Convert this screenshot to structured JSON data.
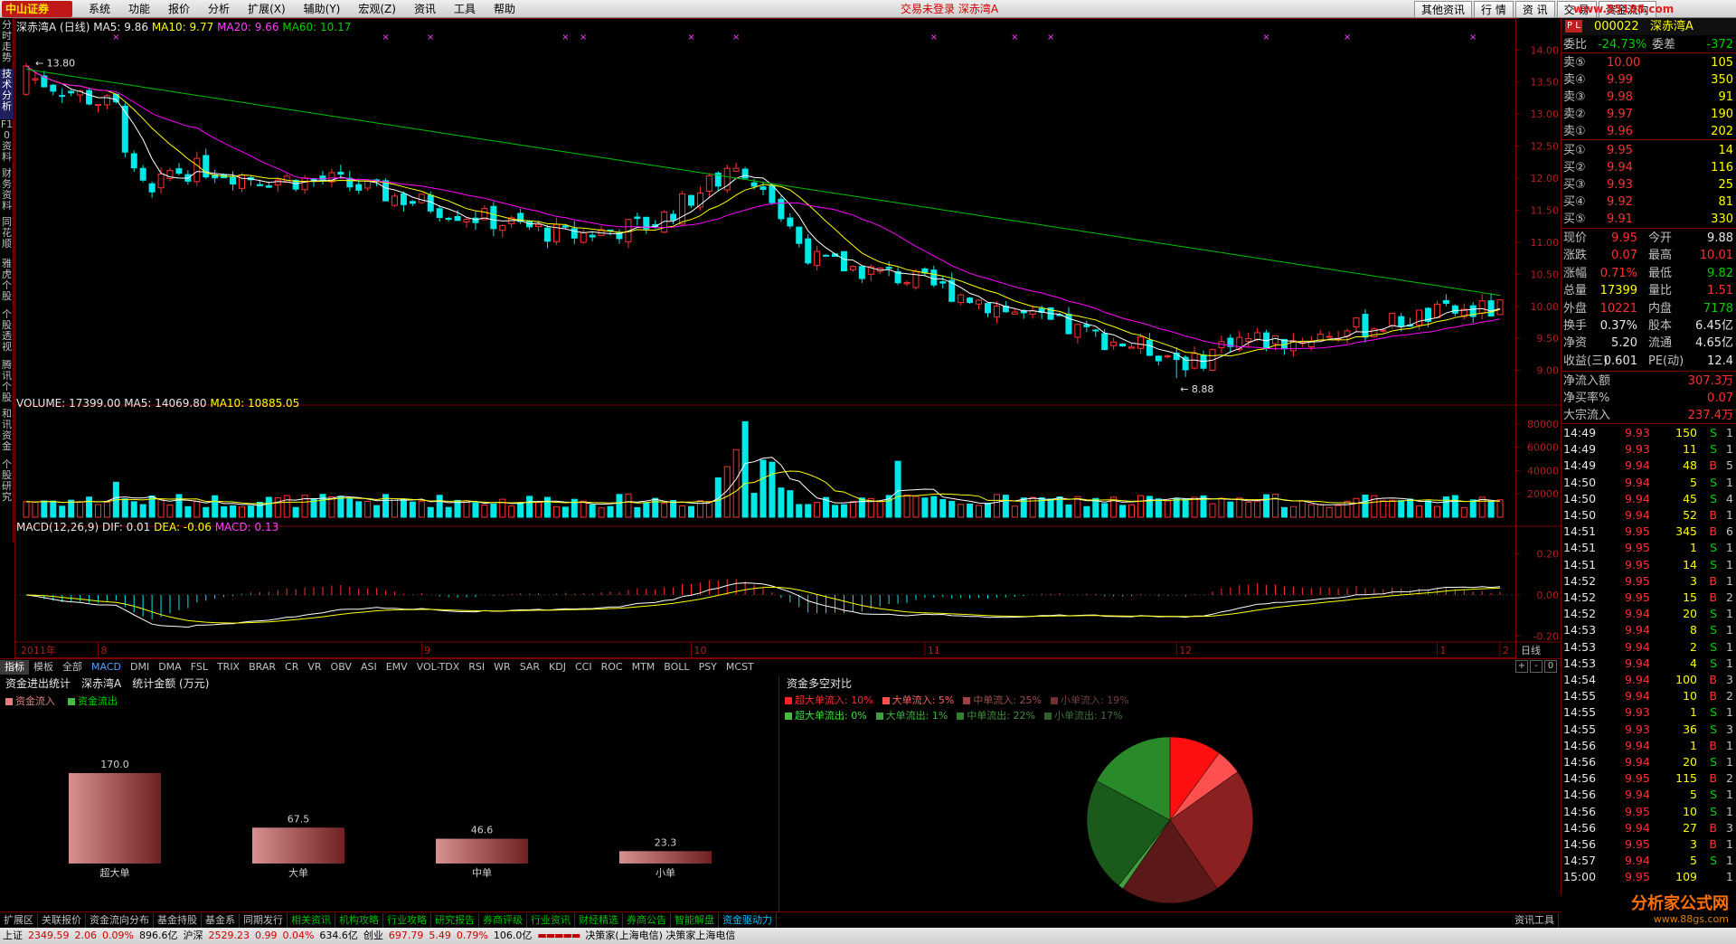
{
  "app": {
    "logo_text": "中山证券",
    "menu": [
      "系统",
      "功能",
      "报价",
      "分析",
      "扩展(X)",
      "辅助(Y)",
      "宏观(Z)",
      "资讯",
      "工具",
      "帮助"
    ],
    "login_status": "交易未登录   深赤湾A",
    "top_tabs": [
      "其他资讯",
      "行 情",
      "资 讯",
      "交 易",
      "资金流向"
    ],
    "watermark": "www.55188.com"
  },
  "left_tabs": [
    "分时走势",
    "技术分析",
    "F10资料",
    "财务资料",
    "同花顺",
    "雅虎个股",
    "个股透视",
    "腾讯个股",
    "和讯资金",
    "个股研究"
  ],
  "kline_header": {
    "title": "深赤湾A (日线)",
    "ma5": "MA5: 9.86",
    "ma10": "MA10: 9.77",
    "ma20": "MA20: 9.66",
    "ma60": "MA60: 10.17",
    "high_mark": "13.80",
    "low_mark": "8.88"
  },
  "volume_header": {
    "vol": "VOLUME: 17399.00",
    "ma5": "MA5: 14069.80",
    "ma10": "MA10: 10885.05"
  },
  "macd_header": {
    "name": "MACD(12,26,9)",
    "dif": "DIF: 0.01",
    "dea": "DEA: -0.06",
    "macd": "MACD: 0.13"
  },
  "x_axis": {
    "labels": [
      "2011年",
      "8",
      "9",
      "10",
      "11",
      "12",
      "1",
      "2"
    ],
    "period": "日线"
  },
  "indicator_tabs": [
    "指标",
    "模板",
    "全部",
    "MACD",
    "DMI",
    "DMA",
    "FSL",
    "TRIX",
    "BRAR",
    "CR",
    "VR",
    "OBV",
    "ASI",
    "EMV",
    "VOL-TDX",
    "RSI",
    "WR",
    "SAR",
    "KDJ",
    "CCI",
    "ROC",
    "MTM",
    "BOLL",
    "PSY",
    "MCST"
  ],
  "indicator_ctrls": [
    "+",
    "-",
    "0"
  ],
  "chart_data": [
    {
      "type": "candlestick",
      "title": "深赤湾A (日线)",
      "ylim": [
        8.6,
        14.3
      ],
      "y_ticks": [
        9.0,
        9.5,
        10.0,
        10.5,
        11.0,
        11.5,
        12.0,
        12.5,
        13.0,
        13.5,
        14.0
      ],
      "series": [
        {
          "name": "MA5",
          "color": "#ffffff"
        },
        {
          "name": "MA10",
          "color": "#ffff00"
        },
        {
          "name": "MA20",
          "color": "#ff00ff"
        },
        {
          "name": "MA60",
          "color": "#00c000"
        }
      ],
      "annotations": [
        "13.80",
        "8.88"
      ]
    },
    {
      "type": "bar",
      "title": "VOLUME",
      "ylim": [
        0,
        90000
      ],
      "y_ticks": [
        20000,
        40000,
        60000,
        80000
      ]
    },
    {
      "type": "bar",
      "title": "MACD(12,26,9)",
      "ylim": [
        -0.3,
        0.3
      ],
      "y_ticks": [
        0.2,
        0.0,
        -0.2
      ],
      "y_tick_labels": [
        "0.20",
        "0.00",
        "-0.20"
      ]
    },
    {
      "type": "bar",
      "title": "资金进出统计",
      "categories": [
        "超大单",
        "大单",
        "中单",
        "小单"
      ],
      "values": [
        170.0,
        67.5,
        46.6,
        23.3
      ],
      "value_labels": [
        "170.0",
        "67.5",
        "46.6",
        "23.3"
      ]
    },
    {
      "type": "pie",
      "title": "资金多空对比",
      "categories": [
        "超大单流入",
        "大单流入",
        "中单流入",
        "小单流入",
        "超大单流出",
        "大单流出",
        "中单流出",
        "小单流出"
      ],
      "values": [
        10,
        5,
        25,
        19,
        0,
        1,
        22,
        17
      ],
      "colors": [
        "#ff1010",
        "#ff5050",
        "#8a2020",
        "#5a1818",
        "#105010",
        "#40a040",
        "#1a5a1a",
        "#2a8a2a"
      ]
    }
  ],
  "panel_left": {
    "tabs": [
      "资金进出统计",
      "深赤湾A",
      "统计金额 (万元)"
    ],
    "legend_in": "资金流入",
    "legend_out": "资金流出"
  },
  "panel_right": {
    "title": "资金多空对比",
    "legend_row1": [
      "超大单流入: 10%",
      "大单流入:   5%",
      "中单流入: 25%",
      "小单流入: 19%"
    ],
    "legend_row2": [
      "超大单流出:  0%",
      "大单流出:   1%",
      "中单流出: 22%",
      "小单流出: 17%"
    ]
  },
  "quote": {
    "code": "000022",
    "name": "深赤湾A",
    "webi_label": "委比",
    "webi": "-24.73%",
    "weicha_label": "委差",
    "weicha": "-372",
    "asks": [
      {
        "label": "卖⑤",
        "price": "10.00",
        "vol": "105"
      },
      {
        "label": "卖④",
        "price": "9.99",
        "vol": "350"
      },
      {
        "label": "卖③",
        "price": "9.98",
        "vol": "91"
      },
      {
        "label": "卖②",
        "price": "9.97",
        "vol": "190"
      },
      {
        "label": "卖①",
        "price": "9.96",
        "vol": "202"
      }
    ],
    "bids": [
      {
        "label": "买①",
        "price": "9.95",
        "vol": "14"
      },
      {
        "label": "买②",
        "price": "9.94",
        "vol": "116"
      },
      {
        "label": "买③",
        "price": "9.93",
        "vol": "25"
      },
      {
        "label": "买④",
        "price": "9.92",
        "vol": "81"
      },
      {
        "label": "买⑤",
        "price": "9.91",
        "vol": "330"
      }
    ],
    "stats": [
      {
        "l1": "现价",
        "v1": "9.95",
        "c1": "red",
        "l2": "今开",
        "v2": "9.88",
        "c2": "white"
      },
      {
        "l1": "涨跌",
        "v1": "0.07",
        "c1": "red",
        "l2": "最高",
        "v2": "10.01",
        "c2": "red"
      },
      {
        "l1": "涨幅",
        "v1": "0.71%",
        "c1": "red",
        "l2": "最低",
        "v2": "9.82",
        "c2": "green"
      },
      {
        "l1": "总量",
        "v1": "17399",
        "c1": "yellow",
        "l2": "量比",
        "v2": "1.51",
        "c2": "red"
      },
      {
        "l1": "外盘",
        "v1": "10221",
        "c1": "red",
        "l2": "内盘",
        "v2": "7178",
        "c2": "green"
      },
      {
        "l1": "换手",
        "v1": "0.37%",
        "c1": "white",
        "l2": "股本",
        "v2": "6.45亿",
        "c2": "white"
      },
      {
        "l1": "净资",
        "v1": "5.20",
        "c1": "white",
        "l2": "流通",
        "v2": "4.65亿",
        "c2": "white"
      },
      {
        "l1": "收益(三)",
        "v1": "0.601",
        "c1": "white",
        "l2": "PE(动)",
        "v2": "12.4",
        "c2": "white"
      }
    ],
    "flows": [
      {
        "label": "净流入额",
        "value": "307.3万"
      },
      {
        "label": "净买率%",
        "value": "0.07"
      },
      {
        "label": "大宗流入",
        "value": "237.4万"
      }
    ],
    "ticks": [
      {
        "time": "14:49",
        "price": "9.93",
        "vol": "150",
        "side": "S",
        "n": "1"
      },
      {
        "time": "14:49",
        "price": "9.93",
        "vol": "11",
        "side": "S",
        "n": "1"
      },
      {
        "time": "14:49",
        "price": "9.94",
        "vol": "48",
        "side": "B",
        "n": "5"
      },
      {
        "time": "14:50",
        "price": "9.94",
        "vol": "5",
        "side": "S",
        "n": "1"
      },
      {
        "time": "14:50",
        "price": "9.94",
        "vol": "45",
        "side": "S",
        "n": "4"
      },
      {
        "time": "14:50",
        "price": "9.94",
        "vol": "52",
        "side": "B",
        "n": "1"
      },
      {
        "time": "14:51",
        "price": "9.95",
        "vol": "345",
        "side": "B",
        "n": "6"
      },
      {
        "time": "14:51",
        "price": "9.95",
        "vol": "1",
        "side": "S",
        "n": "1"
      },
      {
        "time": "14:51",
        "price": "9.95",
        "vol": "14",
        "side": "S",
        "n": "1"
      },
      {
        "time": "14:52",
        "price": "9.95",
        "vol": "3",
        "side": "B",
        "n": "1"
      },
      {
        "time": "14:52",
        "price": "9.95",
        "vol": "15",
        "side": "B",
        "n": "2"
      },
      {
        "time": "14:52",
        "price": "9.94",
        "vol": "20",
        "side": "S",
        "n": "1"
      },
      {
        "time": "14:53",
        "price": "9.94",
        "vol": "8",
        "side": "S",
        "n": "1"
      },
      {
        "time": "14:53",
        "price": "9.94",
        "vol": "2",
        "side": "S",
        "n": "1"
      },
      {
        "time": "14:53",
        "price": "9.94",
        "vol": "4",
        "side": "S",
        "n": "1"
      },
      {
        "time": "14:54",
        "price": "9.94",
        "vol": "100",
        "side": "B",
        "n": "3"
      },
      {
        "time": "14:55",
        "price": "9.94",
        "vol": "10",
        "side": "B",
        "n": "2"
      },
      {
        "time": "14:55",
        "price": "9.93",
        "vol": "1",
        "side": "S",
        "n": "1"
      },
      {
        "time": "14:55",
        "price": "9.93",
        "vol": "36",
        "side": "S",
        "n": "3"
      },
      {
        "time": "14:56",
        "price": "9.94",
        "vol": "1",
        "side": "B",
        "n": "1"
      },
      {
        "time": "14:56",
        "price": "9.94",
        "vol": "20",
        "side": "S",
        "n": "1"
      },
      {
        "time": "14:56",
        "price": "9.95",
        "vol": "115",
        "side": "B",
        "n": "2"
      },
      {
        "time": "14:56",
        "price": "9.94",
        "vol": "5",
        "side": "S",
        "n": "1"
      },
      {
        "time": "14:56",
        "price": "9.95",
        "vol": "10",
        "side": "S",
        "n": "1"
      },
      {
        "time": "14:56",
        "price": "9.94",
        "vol": "27",
        "side": "B",
        "n": "3"
      },
      {
        "time": "14:56",
        "price": "9.95",
        "vol": "3",
        "side": "B",
        "n": "1"
      },
      {
        "time": "14:57",
        "price": "9.94",
        "vol": "5",
        "side": "S",
        "n": "1"
      },
      {
        "time": "15:00",
        "price": "9.95",
        "vol": "109",
        "side": "",
        "n": "1"
      }
    ]
  },
  "links": [
    "扩展区",
    "关联报价",
    "资金流向分布",
    "基金持股",
    "基金系",
    "同期发行",
    "相关资讯",
    "机构攻略",
    "行业攻略",
    "研究报告",
    "券商评级",
    "行业资讯",
    "财经精选",
    "券商公告",
    "智能解盘",
    "资金驱动力"
  ],
  "links_right": "资讯工具",
  "status": {
    "sh_label": "上证",
    "sh_value": "2349.59",
    "sh_chg": "2.06",
    "sh_pct": "0.09%",
    "sh_amt": "896.6亿",
    "hs_label": "沪深",
    "hs_value": "2529.23",
    "hs_chg": "0.99",
    "hs_pct": "0.04%",
    "hs_amt": "634.6亿",
    "cy_label": "创业",
    "cy_value": "697.79",
    "cy_chg": "5.49",
    "cy_pct": "0.79%",
    "cy_amt": "106.0亿",
    "server": "决策家(上海电信)  决策家上海电信"
  },
  "bottom_logo": {
    "main": "分析家公式网",
    "sub": "www.88gs.com"
  }
}
